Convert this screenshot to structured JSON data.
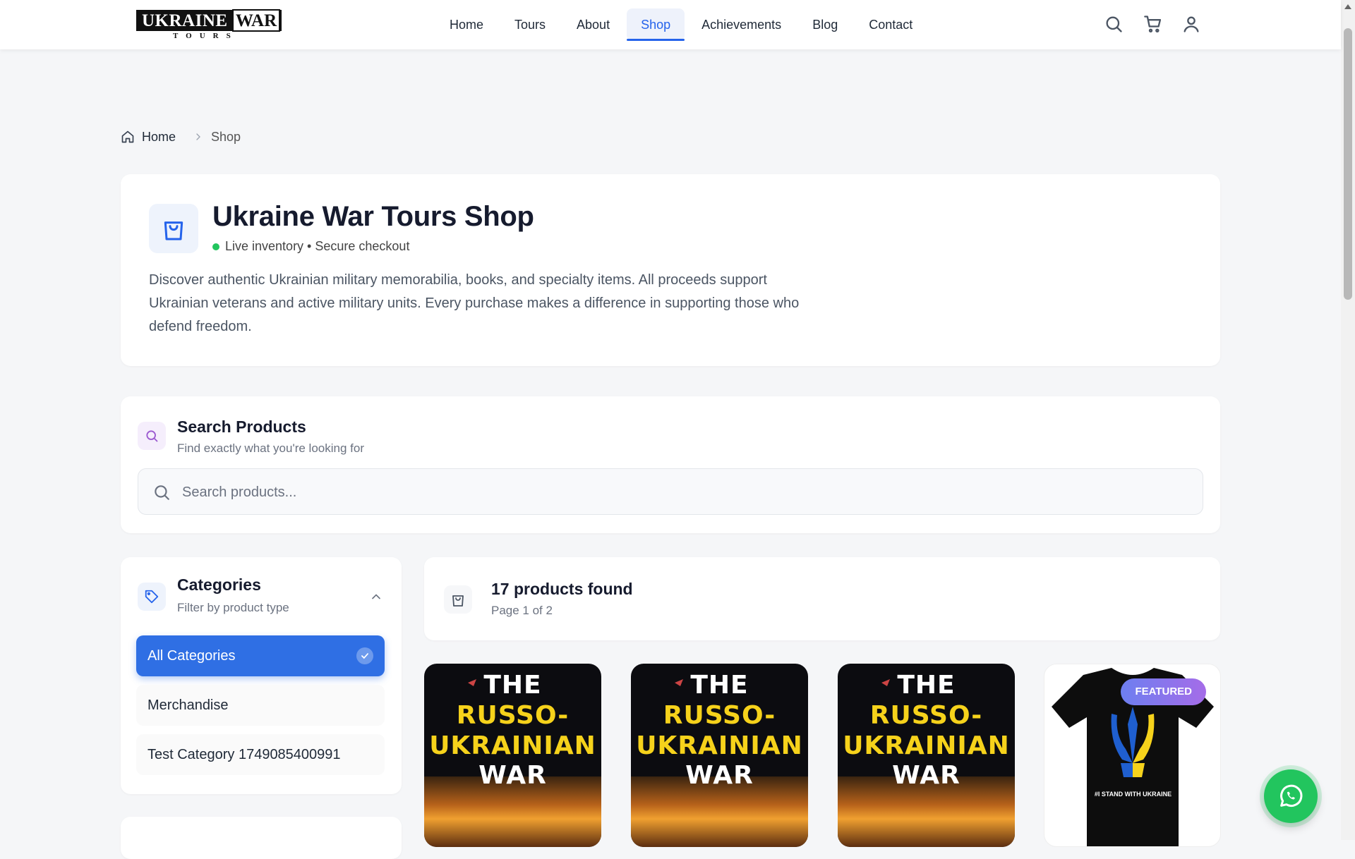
{
  "header": {
    "logo_text_main": "UKRAINE",
    "logo_text_war": "WAR",
    "logo_text_sub": "TOURS",
    "nav": [
      "Home",
      "Tours",
      "About",
      "Shop",
      "Achievements",
      "Blog",
      "Contact"
    ],
    "active_nav": "Shop",
    "icons": [
      "search-icon",
      "cart-icon",
      "user-icon"
    ]
  },
  "breadcrumb": {
    "home": "Home",
    "current": "Shop"
  },
  "hero": {
    "title": "Ukraine War Tours Shop",
    "status": "Live inventory • Secure checkout",
    "description": "Discover authentic Ukrainian military memorabilia, books, and specialty items. All proceeds support Ukrainian veterans and active military units. Every purchase makes a difference in supporting those who defend freedom."
  },
  "search": {
    "title": "Search Products",
    "subtitle": "Find exactly what you're looking for",
    "placeholder": "Search products..."
  },
  "categories": {
    "title": "Categories",
    "subtitle": "Filter by product type",
    "items": [
      "All Categories",
      "Merchandise",
      "Test Category 1749085400991"
    ],
    "selected": "All Categories"
  },
  "results": {
    "count_text": "17 products found",
    "page_text": "Page 1 of 2"
  },
  "products": [
    {
      "type": "book",
      "cover_line1": "THE",
      "cover_line2": "RUSSO-",
      "cover_line3": "UKRAINIAN",
      "cover_line4": "WAR"
    },
    {
      "type": "book",
      "cover_line1": "THE",
      "cover_line2": "RUSSO-",
      "cover_line3": "UKRAINIAN",
      "cover_line4": "WAR"
    },
    {
      "type": "book",
      "cover_line1": "THE",
      "cover_line2": "RUSSO-",
      "cover_line3": "UKRAINIAN",
      "cover_line4": "WAR"
    },
    {
      "type": "shirt",
      "badge": "FEATURED",
      "shirt_text": "#I STAND WITH UKRAINE"
    }
  ],
  "colors": {
    "accent": "#2563eb",
    "active_category": "#2f6fe4",
    "live_dot": "#22c55e",
    "whatsapp": "#22c55e",
    "badge_from": "#6d7ff0",
    "badge_to": "#a56ce8",
    "cover_yellow": "#f6d21b"
  }
}
